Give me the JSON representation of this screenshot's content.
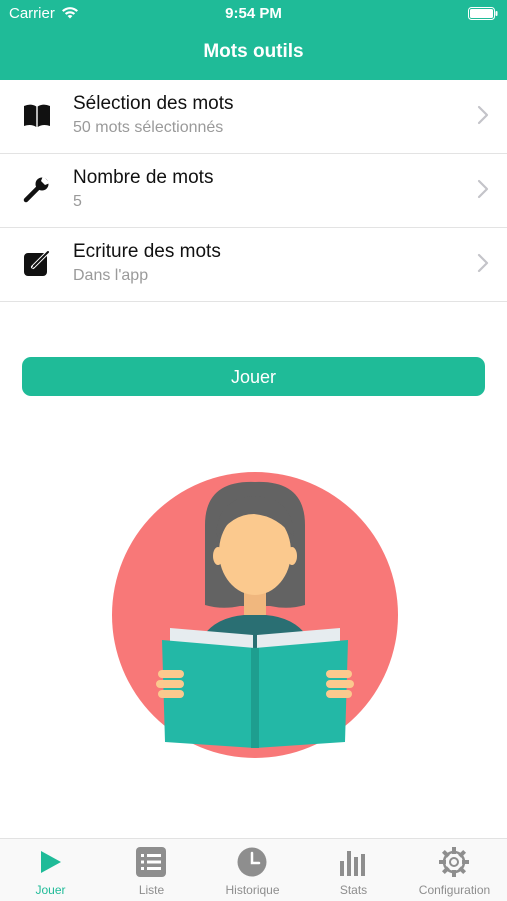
{
  "status_bar": {
    "carrier": "Carrier",
    "time": "9:54 PM"
  },
  "nav": {
    "title": "Mots outils"
  },
  "settings": [
    {
      "title": "Sélection des mots",
      "subtitle": "50 mots sélectionnés",
      "icon": "book-icon"
    },
    {
      "title": "Nombre de mots",
      "subtitle": "5",
      "icon": "wrench-icon"
    },
    {
      "title": "Ecriture des mots",
      "subtitle": "Dans l'app",
      "icon": "edit-icon"
    }
  ],
  "play_button": {
    "label": "Jouer"
  },
  "tabbar": {
    "active": "Jouer",
    "tabs": [
      {
        "label": "Jouer",
        "icon": "play-icon"
      },
      {
        "label": "Liste",
        "icon": "list-icon"
      },
      {
        "label": "Historique",
        "icon": "clock-icon"
      },
      {
        "label": "Stats",
        "icon": "bar-chart-icon"
      },
      {
        "label": "Configuration",
        "icon": "gear-icon"
      }
    ]
  },
  "colors": {
    "accent": "#1fbb98",
    "circle": "#f87878",
    "book": "#23b8a6",
    "hair": "#636363",
    "skin": "#fbc98e"
  }
}
